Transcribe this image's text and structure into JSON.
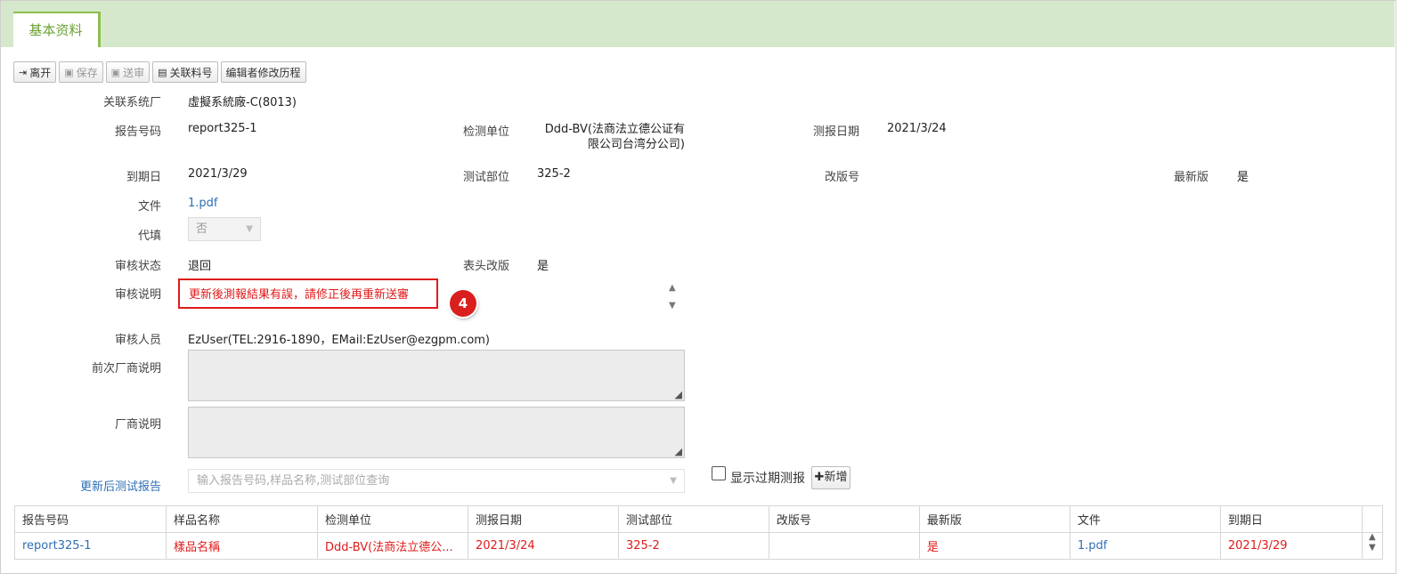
{
  "tab": "基本资料",
  "toolbar": {
    "leave": "离开",
    "save": "保存",
    "submit": "送审",
    "related_no": "关联料号",
    "edit_history": "编辑者修改历程"
  },
  "form": {
    "related_factory_label": "关联系统厂",
    "related_factory_value": "虛擬系統廠-C(8013)",
    "report_no_label": "报告号码",
    "report_no_value": "report325-1",
    "test_unit_label": "检测单位",
    "test_unit_value_line1": "Ddd-BV(法商法立德公证有",
    "test_unit_value_line2": "限公司台湾分公司)",
    "test_date_label": "测报日期",
    "test_date_value": "2021/3/24",
    "expiry_label": "到期日",
    "expiry_value": "2021/3/29",
    "test_part_label": "测试部位",
    "test_part_value": "325-2",
    "revision_label": "改版号",
    "revision_value": "",
    "latest_label": "最新版",
    "latest_value": "是",
    "file_label": "文件",
    "file_value": "1.pdf",
    "proxy_label": "代填",
    "proxy_value": "否",
    "review_status_label": "审核状态",
    "review_status_value": "退回",
    "header_rev_label": "表头改版",
    "header_rev_value": "是",
    "review_note_label": "审核说明",
    "review_note_value": "更新後測報結果有誤，請修正後再重新送審",
    "badge": "4",
    "reviewer_label": "审核人员",
    "reviewer_value": "EzUser(TEL:2916-1890，EMail:EzUser@ezgpm.com)",
    "prev_vendor_note_label": "前次厂商说明",
    "vendor_note_label": "厂商说明",
    "updated_report_label": "更新后测试报告",
    "search_placeholder": "输入报告号码,样品名称,测试部位查询",
    "show_expired_label": "显示过期测报",
    "add_label": "✚新增"
  },
  "table": {
    "headers": [
      "报告号码",
      "样品名称",
      "检测单位",
      "测报日期",
      "测试部位",
      "改版号",
      "最新版",
      "文件",
      "到期日"
    ],
    "rows": [
      [
        "report325-1",
        "樣品名稱",
        "Ddd-BV(法商法立德公...",
        "2021/3/24",
        "325-2",
        "",
        "是",
        "1.pdf",
        "2021/3/29"
      ]
    ]
  }
}
